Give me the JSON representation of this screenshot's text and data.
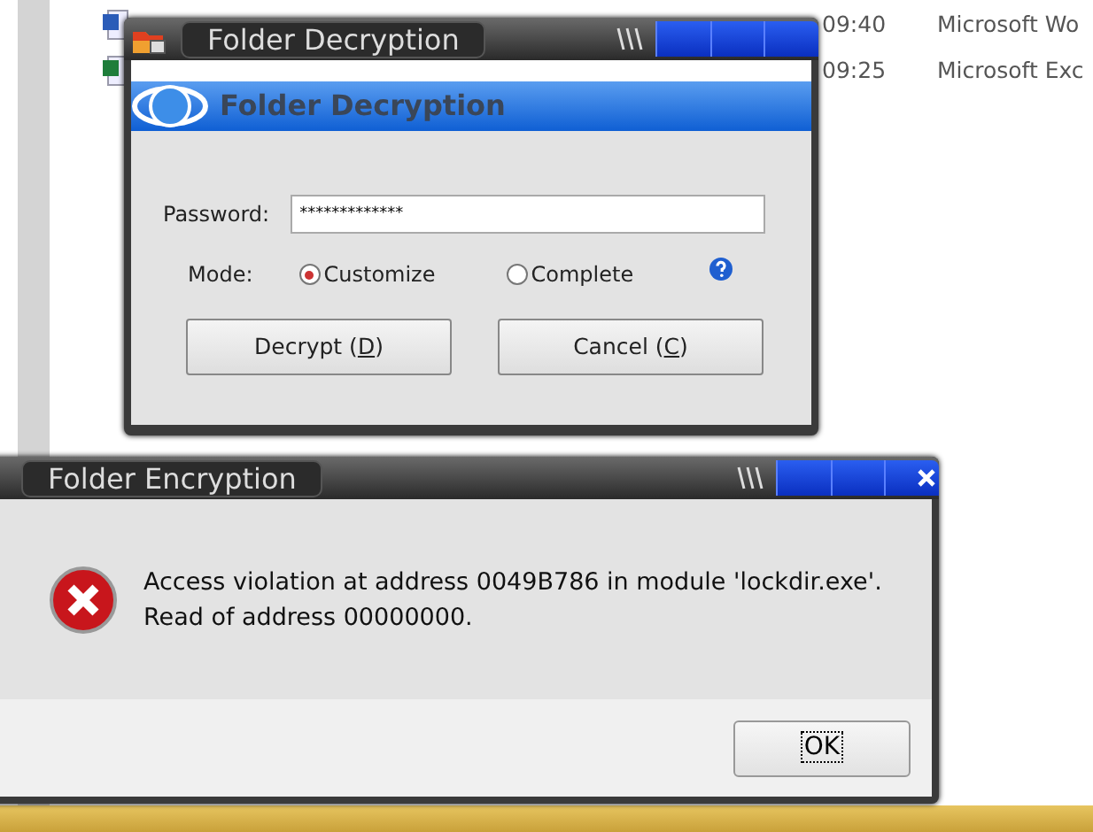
{
  "file_list": [
    {
      "kind": "word",
      "time": "09:40",
      "type": "Microsoft Wo"
    },
    {
      "kind": "excel",
      "time": "09:25",
      "type": "Microsoft Exc"
    }
  ],
  "decrypt_dialog": {
    "title": "Folder Decryption",
    "banner": "Folder Decryption",
    "password_label": "Password:",
    "password_value": "*************",
    "mode_label": "Mode:",
    "modes": [
      {
        "label": "Customize",
        "selected": true
      },
      {
        "label": "Complete",
        "selected": false
      }
    ],
    "buttons": [
      {
        "before": "Decrypt (",
        "key": "D",
        "after": ")"
      },
      {
        "before": "Cancel (",
        "key": "C",
        "after": ")"
      }
    ]
  },
  "error_dialog": {
    "title": "Folder Encryption",
    "message": [
      "Access violation at address 0049B786 in module 'lockdir.exe'.",
      "Read of address 00000000."
    ],
    "button": "OK"
  }
}
